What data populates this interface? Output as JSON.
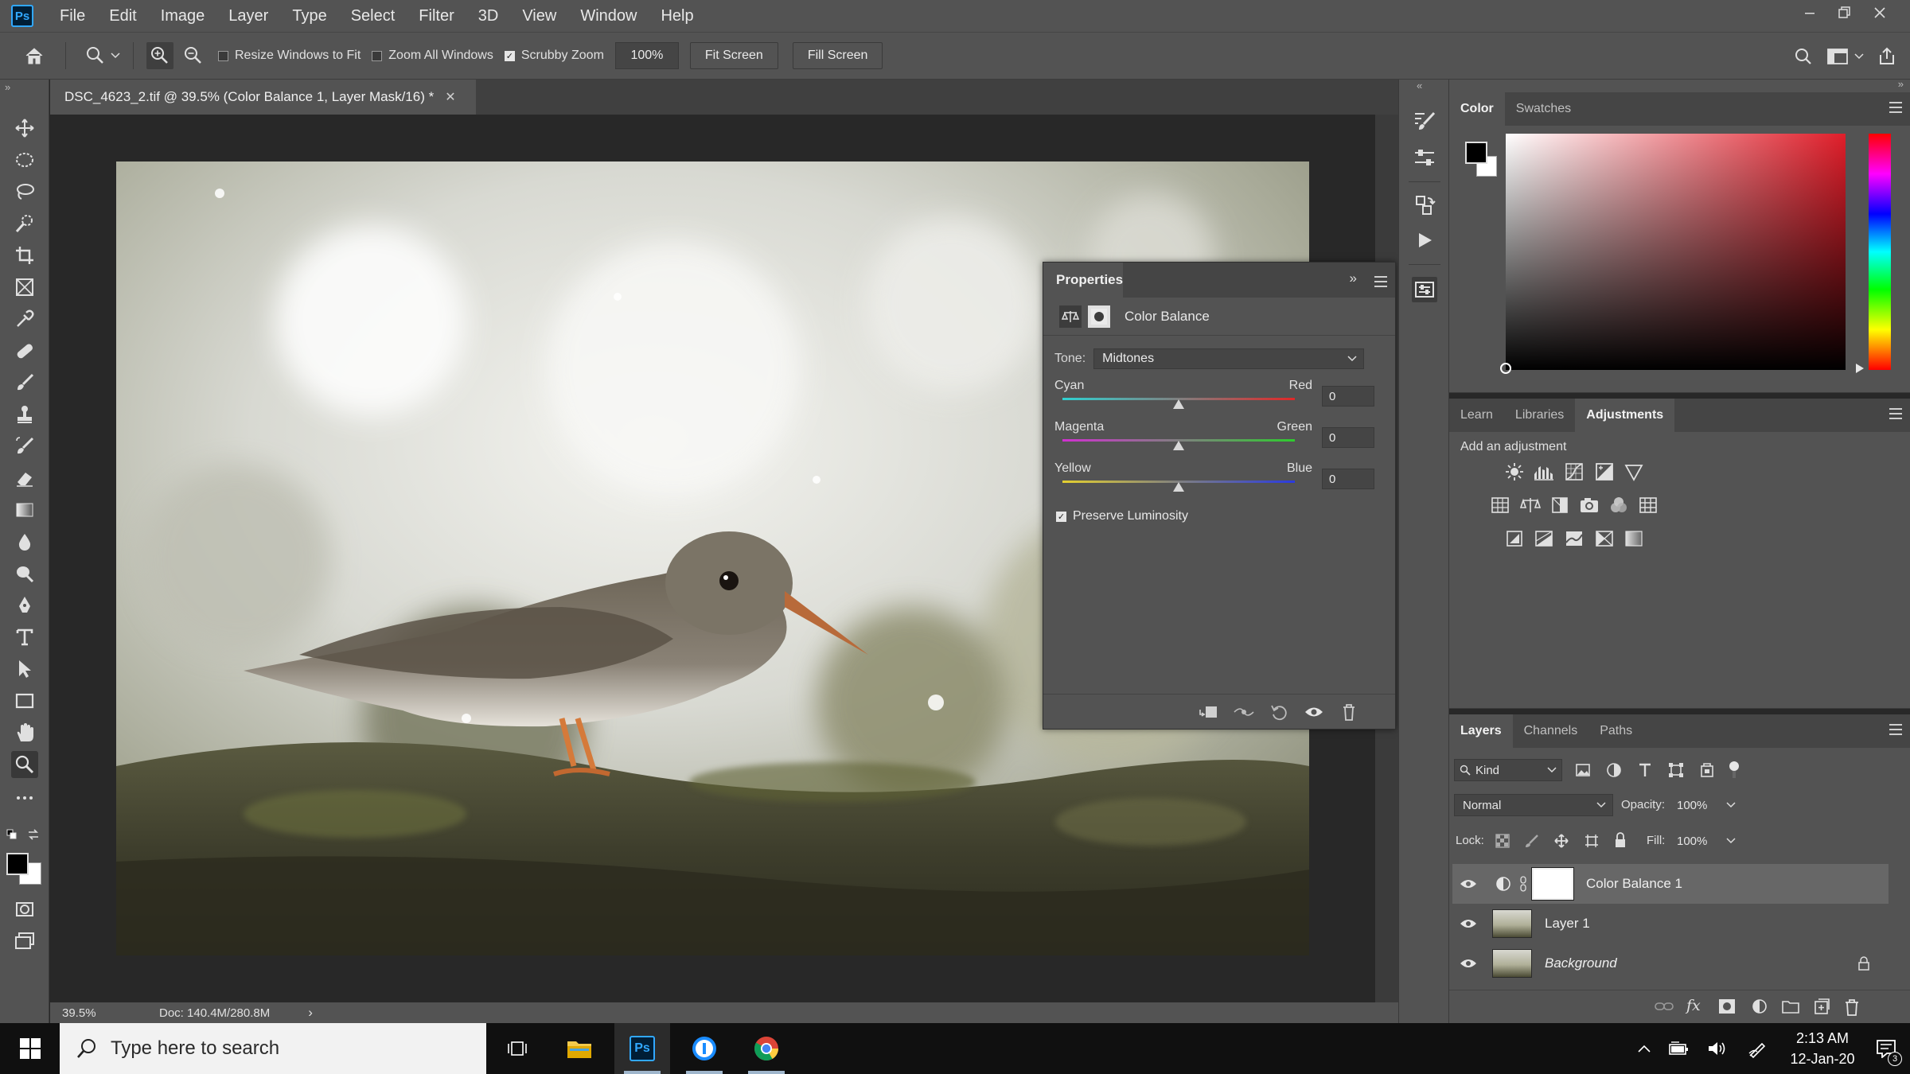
{
  "app": {
    "logo": "Ps"
  },
  "menu": [
    "File",
    "Edit",
    "Image",
    "Layer",
    "Type",
    "Select",
    "Filter",
    "3D",
    "View",
    "Window",
    "Help"
  ],
  "options": {
    "resize_windows": "Resize Windows to Fit",
    "zoom_all": "Zoom All Windows",
    "scrubby_zoom": "Scrubby Zoom",
    "zoom_value": "100%",
    "fit_screen": "Fit Screen",
    "fill_screen": "Fill Screen"
  },
  "document": {
    "tab_title": "DSC_4623_2.tif @ 39.5% (Color Balance 1, Layer Mask/16) *",
    "zoom": "39.5%",
    "doc_size": "Doc: 140.4M/280.8M"
  },
  "properties": {
    "title": "Properties",
    "adjustment": "Color Balance",
    "tone_label": "Tone:",
    "tone_value": "Midtones",
    "sliders": [
      {
        "left": "Cyan",
        "right": "Red",
        "value": "0",
        "level": 0
      },
      {
        "left": "Magenta",
        "right": "Green",
        "value": "0",
        "level": 0
      },
      {
        "left": "Yellow",
        "right": "Blue",
        "value": "0",
        "level": 0
      }
    ],
    "preserve_luminosity": "Preserve Luminosity"
  },
  "color_panel": {
    "tabs": [
      "Color",
      "Swatches"
    ],
    "foreground": "#000000",
    "background": "#ffffff"
  },
  "adjustments_panel": {
    "tabs": [
      "Learn",
      "Libraries",
      "Adjustments"
    ],
    "heading": "Add an adjustment"
  },
  "layers_panel": {
    "tabs": [
      "Layers",
      "Channels",
      "Paths"
    ],
    "kind": "Kind",
    "blend_mode": "Normal",
    "opacity_label": "Opacity:",
    "opacity_value": "100%",
    "lock_label": "Lock:",
    "fill_label": "Fill:",
    "fill_value": "100%",
    "layers": [
      {
        "name": "Color Balance 1"
      },
      {
        "name": "Layer 1"
      },
      {
        "name": "Background"
      }
    ]
  },
  "taskbar": {
    "search_placeholder": "Type here to search",
    "time": "2:13 AM",
    "date": "12-Jan-20",
    "notifications": "3"
  }
}
